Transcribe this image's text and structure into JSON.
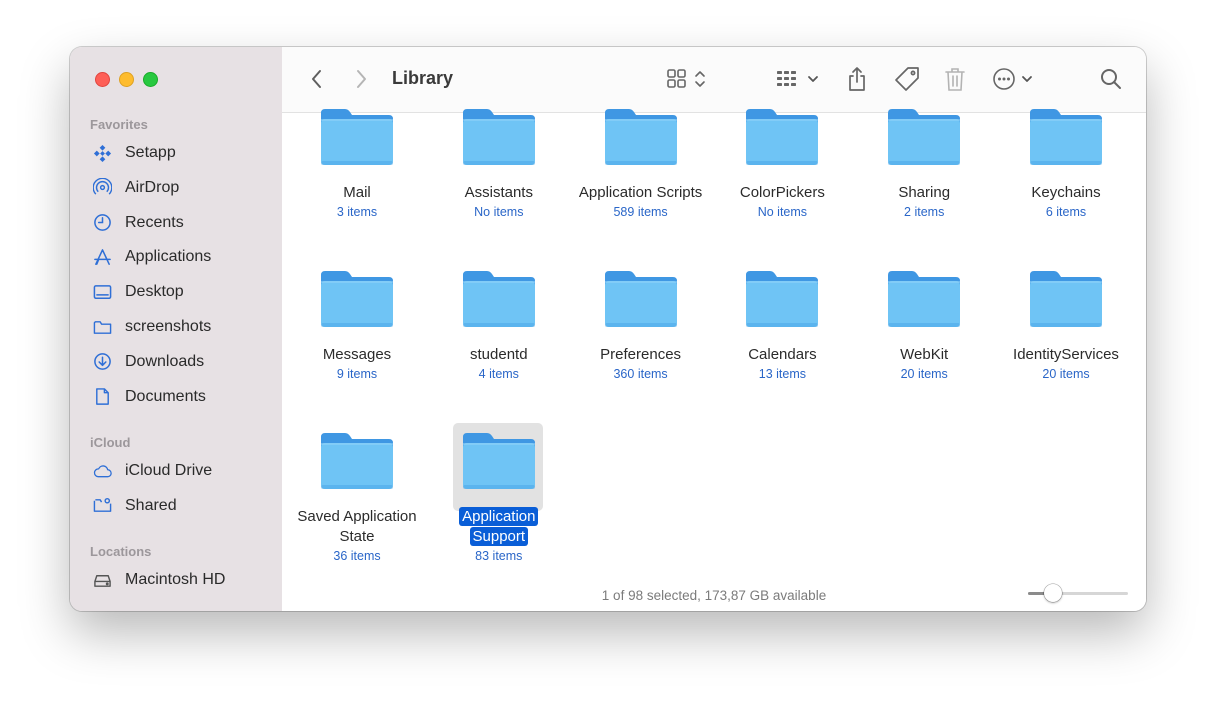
{
  "window": {
    "title": "Library"
  },
  "sidebar": {
    "favorites_header": "Favorites",
    "icloud_header": "iCloud",
    "locations_header": "Locations",
    "favorites": [
      {
        "label": "Setapp",
        "icon": "setapp-icon"
      },
      {
        "label": "AirDrop",
        "icon": "airdrop-icon"
      },
      {
        "label": "Recents",
        "icon": "clock-icon"
      },
      {
        "label": "Applications",
        "icon": "applications-icon"
      },
      {
        "label": "Desktop",
        "icon": "desktop-icon"
      },
      {
        "label": "screenshots",
        "icon": "folder-icon"
      },
      {
        "label": "Downloads",
        "icon": "downloads-icon"
      },
      {
        "label": "Documents",
        "icon": "document-icon"
      }
    ],
    "icloud": [
      {
        "label": "iCloud Drive",
        "icon": "cloud-icon"
      },
      {
        "label": "Shared",
        "icon": "shared-folder-icon"
      }
    ],
    "locations": [
      {
        "label": "Macintosh HD",
        "icon": "disk-icon"
      }
    ]
  },
  "folders": [
    {
      "name": "Mail",
      "count": "3 items"
    },
    {
      "name": "Assistants",
      "count": "No items"
    },
    {
      "name": "Application Scripts",
      "count": "589 items"
    },
    {
      "name": "ColorPickers",
      "count": "No items"
    },
    {
      "name": "Sharing",
      "count": "2 items"
    },
    {
      "name": "Keychains",
      "count": "6 items"
    },
    {
      "name": "Messages",
      "count": "9 items"
    },
    {
      "name": "studentd",
      "count": "4 items"
    },
    {
      "name": "Preferences",
      "count": "360 items"
    },
    {
      "name": "Calendars",
      "count": "13 items"
    },
    {
      "name": "WebKit",
      "count": "20 items"
    },
    {
      "name": "IdentityServices",
      "count": "20 items"
    },
    {
      "name": "Saved Application State",
      "count": "36 items"
    },
    {
      "name": "Application Support",
      "count": "83 items",
      "selected": true
    }
  ],
  "status": {
    "text": "1 of 98 selected, 173,87 GB available"
  },
  "icon_size_slider": {
    "value_fraction": 0.25
  },
  "colors": {
    "accent": "#0a5ed7",
    "folder_front": "#6fc4f5",
    "folder_back": "#3f97e3",
    "count_text": "#2a66c8",
    "sidebar_icon": "#2f6fd6"
  }
}
